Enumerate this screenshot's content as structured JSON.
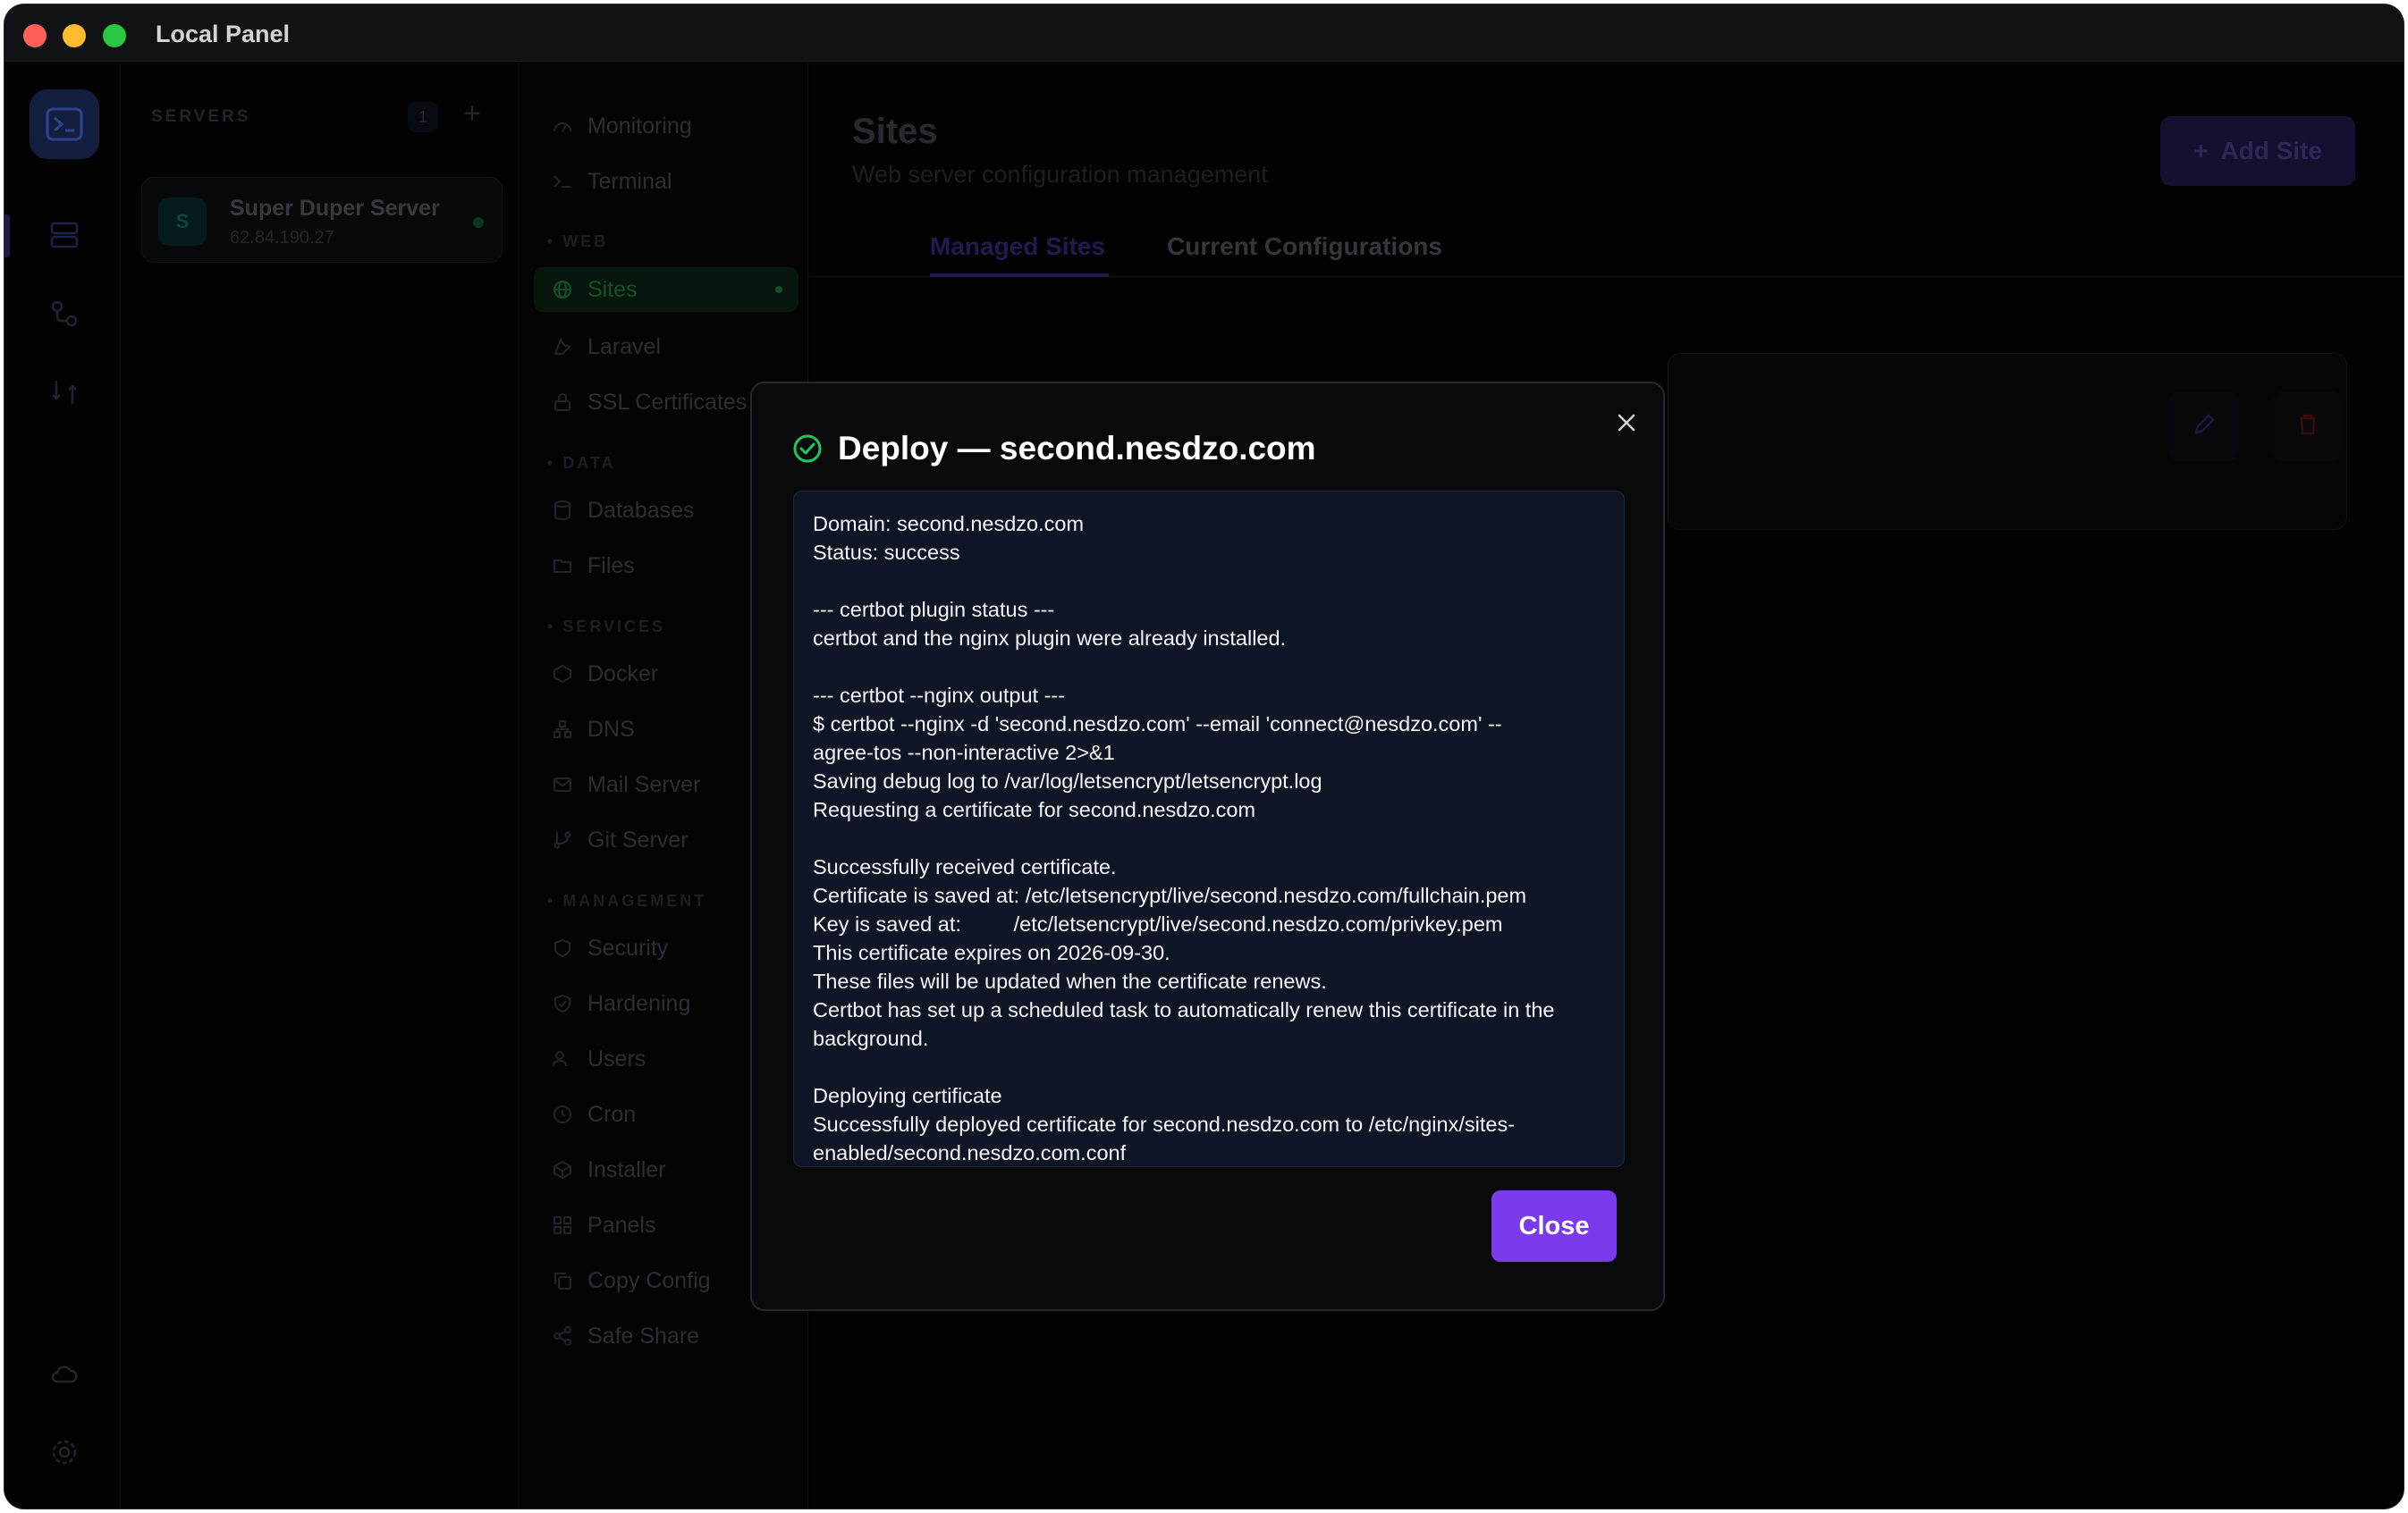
{
  "window": {
    "title": "Local Panel"
  },
  "servers": {
    "heading": "SERVERS",
    "count": "1",
    "add_label": "+",
    "items": [
      {
        "initial": "S",
        "name": "Super Duper Server",
        "ip": "62.84.190.27"
      }
    ]
  },
  "nav": {
    "items": {
      "monitoring": "Monitoring",
      "terminal": "Terminal",
      "sites": "Sites",
      "laravel": "Laravel",
      "ssl": "SSL Certificates",
      "databases": "Databases",
      "files": "Files",
      "docker": "Docker",
      "dns": "DNS",
      "mail": "Mail Server",
      "git": "Git Server",
      "security": "Security",
      "hardening": "Hardening",
      "users": "Users",
      "cron": "Cron",
      "installer": "Installer",
      "panels": "Panels",
      "copy_config": "Copy Config",
      "safe_share": "Safe Share"
    },
    "sections": {
      "web": "WEB",
      "data": "DATA",
      "services": "SERVICES",
      "management": "MANAGEMENT"
    }
  },
  "main": {
    "title": "Sites",
    "subtitle": "Web server configuration management",
    "add_button": "Add Site",
    "add_button_icon": "+",
    "tabs": [
      "Managed Sites",
      "Current Configurations"
    ]
  },
  "modal": {
    "title": "Deploy — second.nesdzo.com",
    "close_label": "Close",
    "status_color": "#22c55e",
    "log_lines": [
      "Domain: second.nesdzo.com",
      "Status: success",
      "",
      "--- certbot plugin status ---",
      "certbot and the nginx plugin were already installed.",
      "",
      "--- certbot --nginx output ---",
      "$ certbot --nginx -d 'second.nesdzo.com' --email 'connect@nesdzo.com' --",
      "agree-tos --non-interactive 2>&1",
      "Saving debug log to /var/log/letsencrypt/letsencrypt.log",
      "Requesting a certificate for second.nesdzo.com",
      "",
      "Successfully received certificate.",
      "Certificate is saved at: /etc/letsencrypt/live/second.nesdzo.com/fullchain.pem",
      "Key is saved at:         /etc/letsencrypt/live/second.nesdzo.com/privkey.pem",
      "This certificate expires on 2026-09-30.",
      "These files will be updated when the certificate renews.",
      "Certbot has set up a scheduled task to automatically renew this certificate in the",
      "background.",
      "",
      "Deploying certificate",
      "Successfully deployed certificate for second.nesdzo.com to /etc/nginx/sites-",
      "enabled/second.nesdzo.com.conf"
    ]
  },
  "colors": {
    "accent": "#7c3aed",
    "success": "#22c55e"
  }
}
